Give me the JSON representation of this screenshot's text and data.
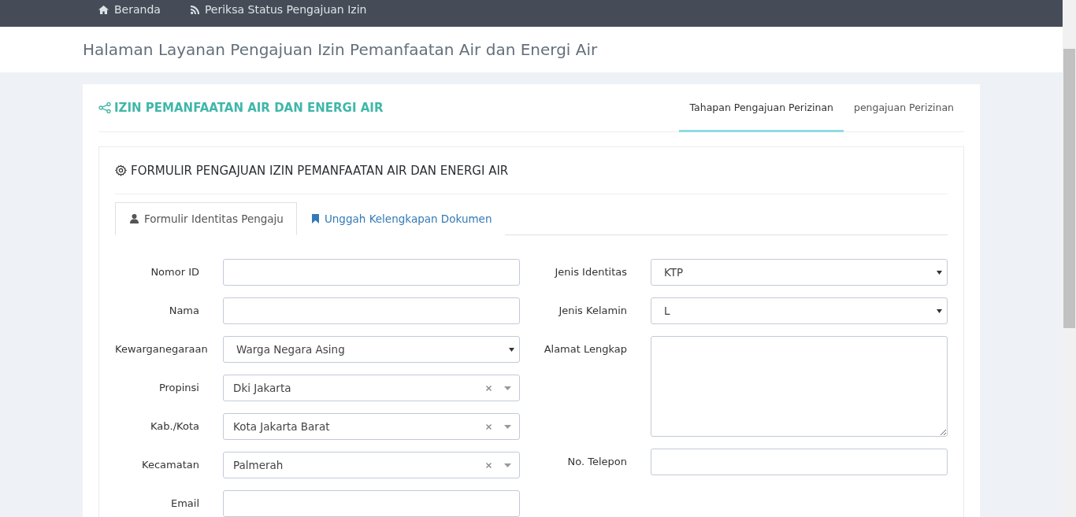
{
  "nav": {
    "items": [
      {
        "label": "Beranda"
      },
      {
        "label": "Periksa Status Pengajuan Izin"
      }
    ]
  },
  "page_title": "Halaman Layanan Pengajuan Izin Pemanfaatan Air dan Energi Air",
  "card": {
    "title": "IZIN PEMANFAATAN AIR DAN ENERGI AIR",
    "tabs": [
      {
        "label": "Tahapan Pengajuan Perizinan",
        "selected": true
      },
      {
        "label": "pengajuan Perizinan",
        "selected": false
      }
    ]
  },
  "form_panel": {
    "title": "FORMULIR PENGAJUAN IZIN PEMANFAATAN AIR DAN ENERGI AIR",
    "tabs": [
      {
        "label": "Formulir Identitas Pengaju",
        "selected": true
      },
      {
        "label": "Unggah Kelengkapan Dokumen",
        "selected": false
      }
    ],
    "left_fields": [
      {
        "label": "Nomor ID",
        "kind": "text"
      },
      {
        "label": "Nama",
        "kind": "text"
      },
      {
        "label": "Kewarganegaraan",
        "kind": "select",
        "value": "Warga Negara Asing"
      },
      {
        "label": "Propinsi",
        "kind": "select2",
        "value": "Dki Jakarta"
      },
      {
        "label": "Kab./Kota",
        "kind": "select2",
        "value": "Kota Jakarta Barat"
      },
      {
        "label": "Kecamatan",
        "kind": "select2",
        "value": "Palmerah"
      },
      {
        "label": "Email",
        "kind": "text"
      }
    ],
    "right_fields": [
      {
        "label": "Jenis Identitas",
        "kind": "select",
        "value": "KTP"
      },
      {
        "label": "Jenis Kelamin",
        "kind": "select",
        "value": "L"
      },
      {
        "label": "Alamat Lengkap",
        "kind": "textarea"
      },
      {
        "label": "No. Telepon",
        "kind": "text"
      }
    ]
  }
}
